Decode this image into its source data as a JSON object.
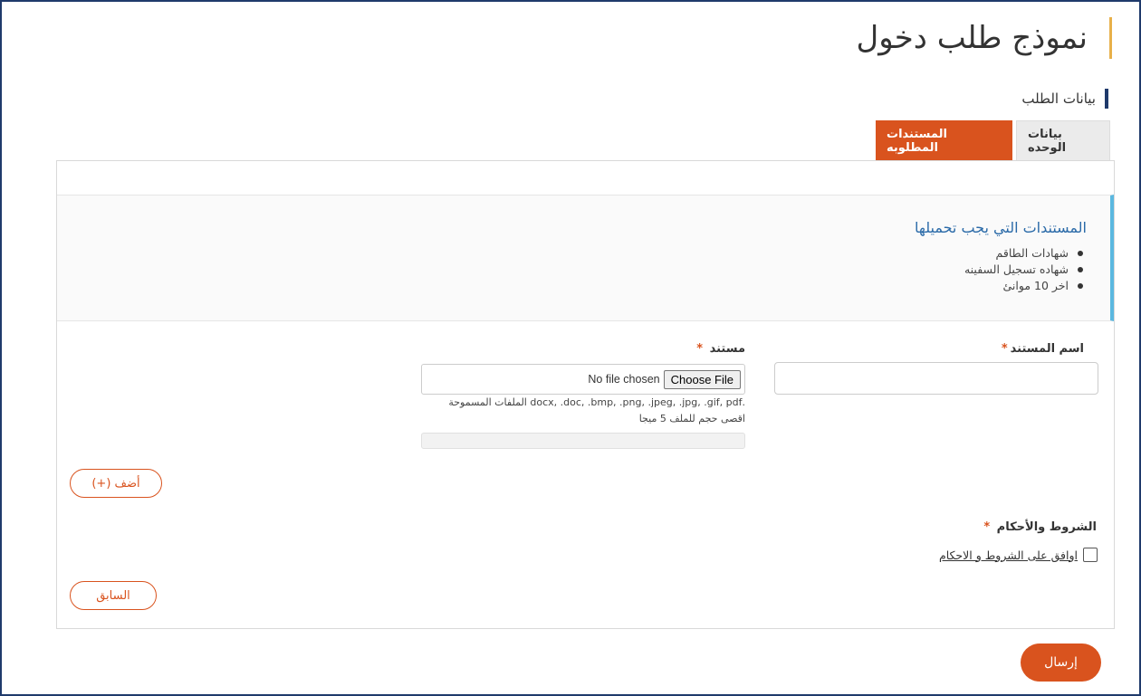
{
  "page": {
    "title": "نموذج طلب دخول"
  },
  "section": {
    "title": "بيانات الطلب"
  },
  "tabs": [
    {
      "label": "بيانات الوحده",
      "active": false
    },
    {
      "label": "المستندات المطلوبه",
      "active": true
    }
  ],
  "notice": {
    "title": "المستندات التي يجب تحميلها",
    "items": [
      "شهادات الطاقم",
      "شهاده تسجيل السفينه",
      "اخر 10 موانئ"
    ]
  },
  "form": {
    "doc_name_label": "اسم المستند",
    "doc_name_value": "",
    "doc_label": "مستند",
    "required_mark": "*",
    "file_button": "Choose File",
    "file_status": "No file chosen",
    "allowed_hint": ".docx, .doc, .bmp, .png, .jpeg, .jpg, .gif, pdf الملفات المسموحة",
    "size_hint": "اقصى حجم للملف 5 ميجا",
    "upload_progress_percent": 0,
    "add_button": "(+) أضف",
    "terms_label": "الشروط والأحكام",
    "terms_checkbox_text": "اوافق على الشروط و الاحكام",
    "terms_checked": false,
    "prev_button": "السابق"
  },
  "submit": {
    "label": "إرسال"
  },
  "colors": {
    "accent": "#d9531e",
    "navy": "#1f3a6b",
    "info_bar": "#5bb8e0",
    "title_bar": "#e8b04a"
  }
}
